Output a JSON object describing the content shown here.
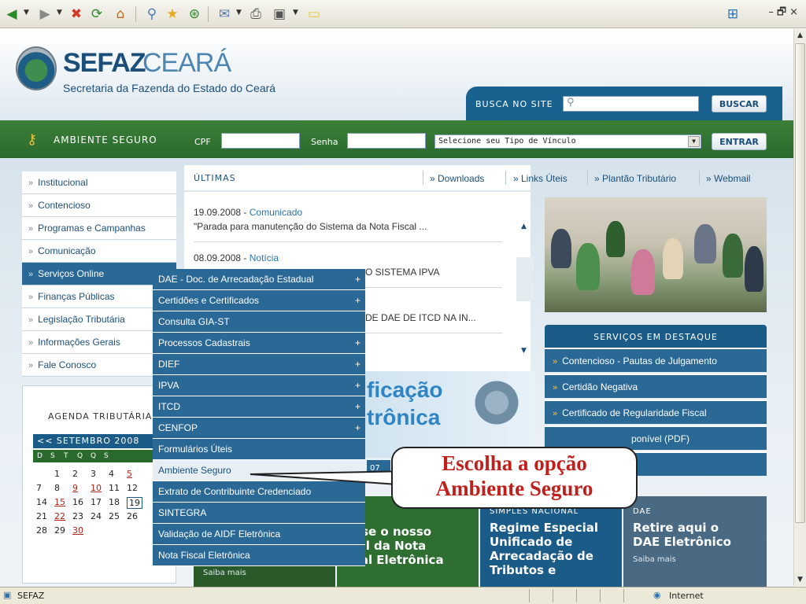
{
  "window": {
    "min_glyph": "–",
    "max_glyph": "🗗",
    "close_glyph": "×"
  },
  "header": {
    "brand_bold": "SEFAZ",
    "brand_light": "CEARÁ",
    "subtitle": "Secretaria da Fazenda do Estado do Ceará",
    "search_label": "BUSCA NO SITE",
    "search_button": "BUSCAR"
  },
  "login": {
    "label": "AMBIENTE SEGURO",
    "cpf_label": "CPF",
    "senha_label": "Senha",
    "vinculo_selected": "Selecione seu Tipo de Vínculo",
    "enter_button": "ENTRAR"
  },
  "nav": {
    "prefix": "»",
    "items": [
      "Institucional",
      "Contencioso",
      "Programas e Campanhas",
      "Comunicação",
      "Serviços Online",
      "Finanças Públicas",
      "Legislação Tributária",
      "Informações Gerais",
      "Fale Conosco"
    ]
  },
  "agenda": {
    "title": "AGENDA TRIBUTÁRIA",
    "month": "<< SETEMBRO 2008",
    "weekdays": [
      "D",
      "S",
      "T",
      "Q",
      "Q",
      "S"
    ],
    "rows": [
      [
        "",
        "1",
        "2",
        "3",
        "4",
        "5"
      ],
      [
        "7",
        "8",
        "9",
        "10",
        "11",
        "12"
      ],
      [
        "14",
        "15",
        "16",
        "17",
        "18",
        "19"
      ],
      [
        "21",
        "22",
        "23",
        "24",
        "25",
        "26"
      ],
      [
        "28",
        "29",
        "30",
        "",
        "",
        ""
      ]
    ]
  },
  "news": {
    "ultimas": "ÚLTIMAS",
    "links": [
      "» Downloads",
      "» Links Úteis",
      "» Plantão Tributário",
      "» Webmail"
    ],
    "items": [
      {
        "date": "19.09.2008 - ",
        "type": "Comunicado",
        "text": "\"Parada para manutenção do Sistema da Nota Fiscal ..."
      },
      {
        "date": "08.09.2008 - ",
        "type": "Notícia",
        "text": "O SISTEMA IPVA"
      },
      {
        "text": "DE DAE DE ITCD NA IN..."
      }
    ],
    "banner_line1": "ficação",
    "banner_line2": "trônica",
    "banner_strip": "07"
  },
  "services": {
    "title": "SERVIÇOS EM DESTAQUE",
    "items": [
      "Contencioso - Pautas de Julgamento",
      "Certidão Negativa",
      "Certificado de Regularidade Fiscal",
      "ponível (PDF)",
      ""
    ]
  },
  "tiles": [
    {
      "kicker": "",
      "headline": "",
      "more": "Saiba mais"
    },
    {
      "kicker": "",
      "headline": "esse o nosso\nrtal da Nota\nscal Eletrônica",
      "more": ""
    },
    {
      "kicker": "SIMPLES NACIONAL",
      "headline": "Regime Especial\nUnificado de\nArrecadação de\nTributos e",
      "more": ""
    },
    {
      "kicker": "DAE",
      "headline": "Retire aqui o\nDAE Eletrônico",
      "more": "Saiba mais"
    }
  ],
  "dropdown": {
    "items": [
      {
        "label": "DAE - Doc. de Arrecadação Estadual",
        "sub": true
      },
      {
        "label": "Certidões e Certificados",
        "sub": true
      },
      {
        "label": "Consulta GIA-ST",
        "sub": false
      },
      {
        "label": "Processos Cadastrais",
        "sub": true
      },
      {
        "label": "DIEF",
        "sub": true
      },
      {
        "label": "IPVA",
        "sub": true
      },
      {
        "label": "ITCD",
        "sub": true
      },
      {
        "label": "CENFOP",
        "sub": true
      },
      {
        "label": "Formulários Úteis",
        "sub": false
      },
      {
        "label": "Ambiente Seguro",
        "sub": false
      },
      {
        "label": "Extrato de Contribuinte Credenciado",
        "sub": false
      },
      {
        "label": "SINTEGRA",
        "sub": false
      },
      {
        "label": "Validação de AIDF Eletrônica",
        "sub": false
      },
      {
        "label": "Nota Fiscal Eletrônica",
        "sub": false
      }
    ],
    "highlighted": 9,
    "plus": "+"
  },
  "callout": {
    "line1": "Escolha a opção",
    "line2": "Ambiente Seguro"
  },
  "status": {
    "text": "SEFAZ",
    "zone": "Internet"
  },
  "colors": {
    "brand_blue": "#1b4f7a",
    "green_bar": "#2f742f",
    "menu_blue": "#2a6896",
    "callout_red": "#c0201c"
  }
}
